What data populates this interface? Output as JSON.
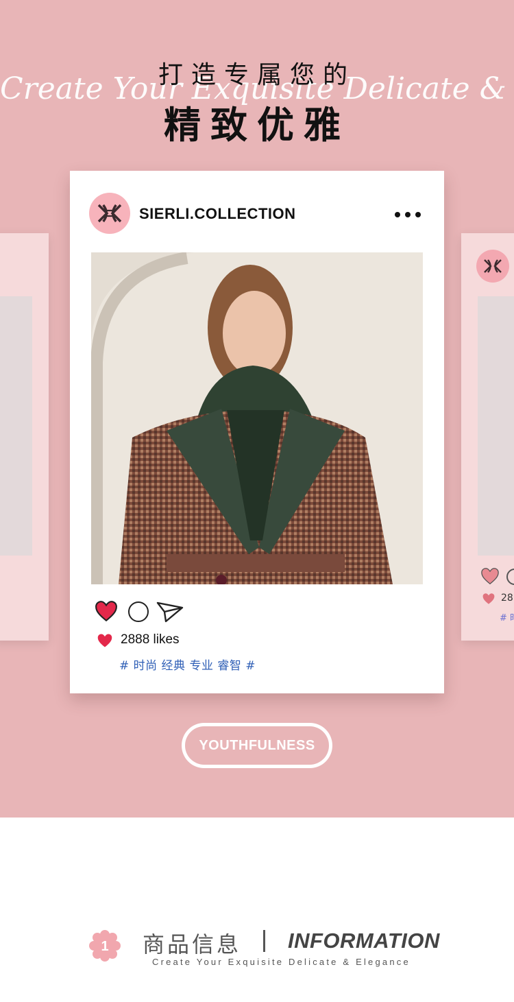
{
  "hero": {
    "title_line1": "打造专属您的",
    "title_line2": "精致优雅",
    "script_text": "Create Your Exquisite Delicate & Elegance",
    "background_color": "#e8b5b7"
  },
  "post": {
    "account": "SIERLI.COLLECTION",
    "avatar_icon": "brand-monogram-icon",
    "more_icon": "more-dots-icon",
    "photo_description_icon": "fashion-photo",
    "actions": [
      "heart-icon",
      "comment-icon",
      "send-icon"
    ],
    "likes_text": "2888 likes",
    "tags": "# 时尚 经典 专业 睿智 #",
    "like_color": "#e3284a",
    "tag_color": "#2f5fb6"
  },
  "side_card_right": {
    "likes_text": "28",
    "tag_text": "# 时"
  },
  "badge": {
    "label": "YOUTHFULNESS"
  },
  "info": {
    "number": "1",
    "title_cn": "商品信息",
    "title_en": "INFORMATION",
    "subtitle": "Create Your Exquisite Delicate & Elegance"
  }
}
